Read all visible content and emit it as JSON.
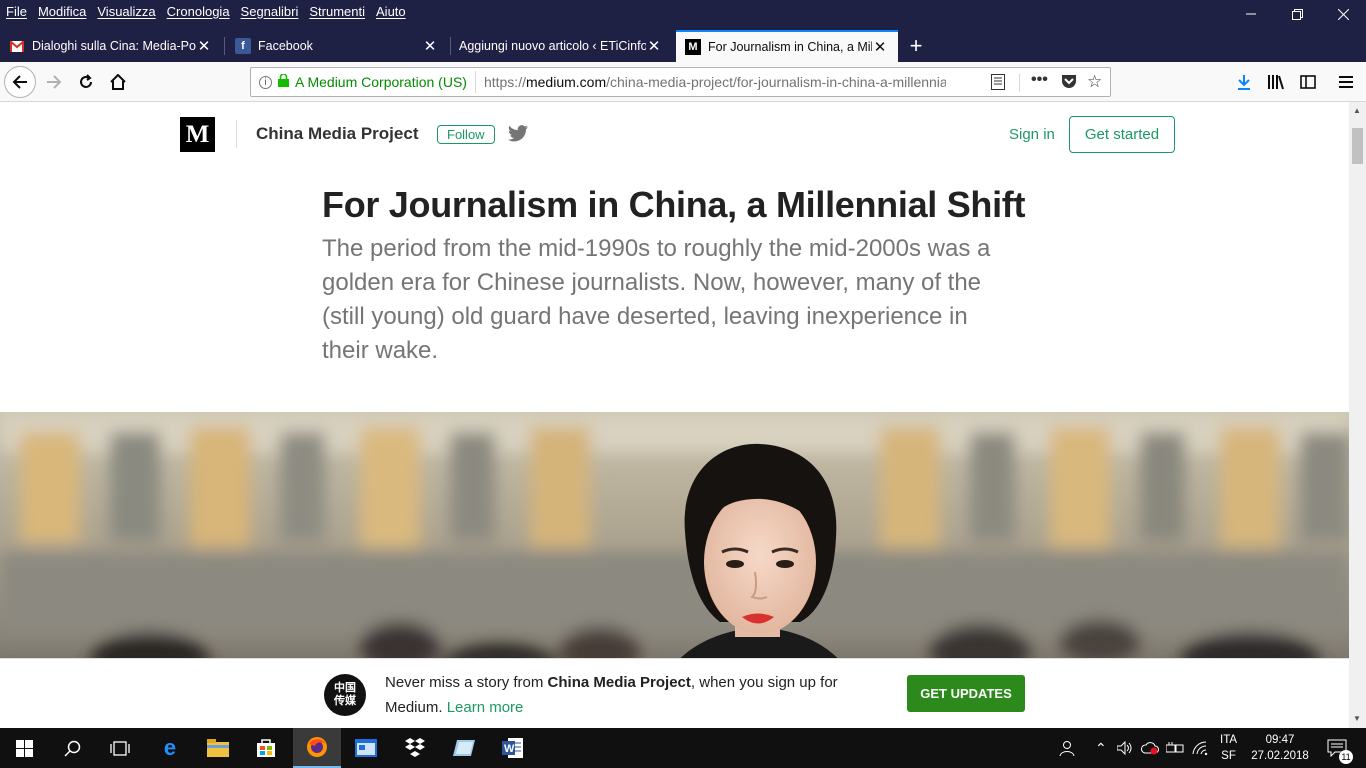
{
  "menu": [
    "File",
    "Modifica",
    "Visualizza",
    "Cronologia",
    "Segnalibri",
    "Strumenti",
    "Aiuto"
  ],
  "tabs": [
    {
      "title": "Dialoghi sulla Cina: Media-Poli",
      "icon": "gmail-icon"
    },
    {
      "title": "Facebook",
      "icon": "facebook-icon"
    },
    {
      "title": "Aggiungi nuovo articolo ‹ ETiCinfo",
      "icon": ""
    },
    {
      "title": "For Journalism in China, a Mille",
      "icon": "medium-icon"
    }
  ],
  "urlbar": {
    "identity": "A Medium Corporation (US)",
    "url_prefix": "https://",
    "url_host": "medium.com",
    "url_path": "/china-media-project/for-journalism-in-china-a-millennia"
  },
  "header": {
    "logo": "M",
    "publication": "China Media Project",
    "follow": "Follow",
    "signin": "Sign in",
    "get_started": "Get started"
  },
  "article": {
    "title": "For Journalism in China, a Millennial Shift",
    "subtitle": "The period from the mid-1990s to roughly the mid-2000s was a golden era for Chinese journalists. Now, however, many of the (still young) old guard have deserted, leaving inexperience in their wake."
  },
  "banner": {
    "avatar_text": "中国传媒",
    "text_prefix": "Never miss a story from ",
    "publication": "China Media Project",
    "text_suffix": ", when you sign up for Medium. ",
    "learn_more": "Learn more",
    "button": "GET UPDATES"
  },
  "taskbar": {
    "lang": "ITA",
    "lang_sub": "SF",
    "time": "09:47",
    "date": "27.02.2018",
    "notifications": "11"
  },
  "colors": {
    "titlebar": "#1e2044",
    "medium_green": "#1c9963",
    "update_button": "#2b8a1b"
  }
}
